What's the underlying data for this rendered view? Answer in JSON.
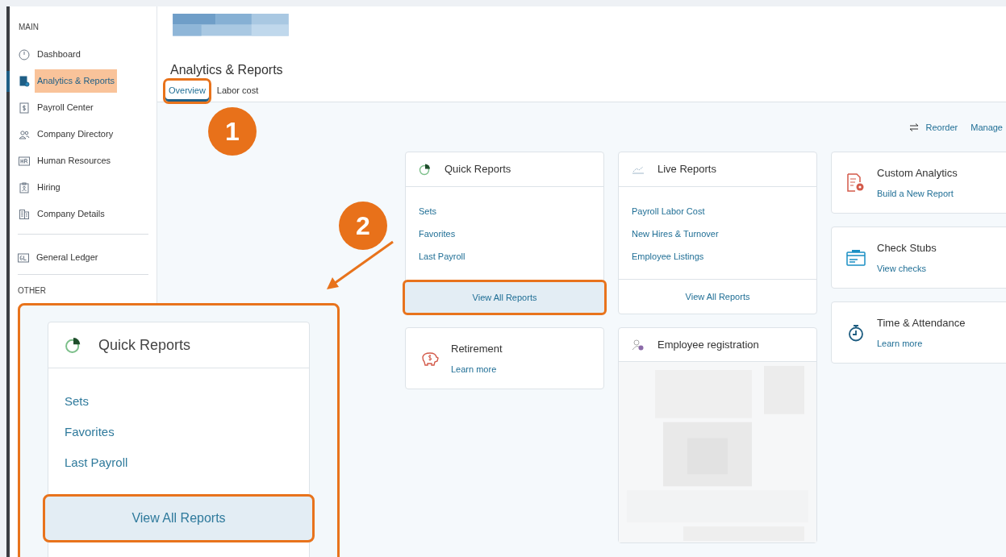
{
  "sidebar": {
    "sections": [
      {
        "heading": "MAIN",
        "items": [
          {
            "label": "Dashboard",
            "kind": "gauge",
            "selected": false
          },
          {
            "label": "Analytics & Reports",
            "kind": "report",
            "selected": true
          },
          {
            "label": "Payroll Center",
            "kind": "dollar",
            "selected": false
          },
          {
            "label": "Company Directory",
            "kind": "people",
            "selected": false
          },
          {
            "label": "Human Resources",
            "kind": "hr",
            "selected": false
          },
          {
            "label": "Hiring",
            "kind": "badge",
            "selected": false
          },
          {
            "label": "Company Details",
            "kind": "building",
            "selected": false
          }
        ]
      },
      {
        "items": [
          {
            "label": "General Ledger",
            "kind": "gl",
            "selected": false
          }
        ]
      },
      {
        "heading": "OTHER"
      }
    ]
  },
  "page": {
    "title": "Analytics & Reports",
    "tabs": [
      {
        "label": "Overview",
        "selected": true,
        "highlighted": true
      },
      {
        "label": "Labor cost",
        "selected": false,
        "highlighted": false
      }
    ]
  },
  "toolbar": {
    "reorder": "Reorder",
    "manage": "Manage"
  },
  "columns": [
    [
      {
        "kind": "list",
        "title": "Quick Reports",
        "links": [
          "Sets",
          "Favorites",
          "Last Payroll"
        ],
        "button": "View All Reports",
        "highlighted": true
      },
      {
        "kind": "promo",
        "title": "Retirement",
        "link": "Learn more"
      }
    ],
    [
      {
        "kind": "list",
        "title": "Live Reports",
        "links": [
          "Payroll Labor Cost",
          "New Hires & Turnover",
          "Employee Listings"
        ],
        "button": "View All Reports",
        "highlighted": false
      },
      {
        "kind": "blurred",
        "title": "Employee registration"
      }
    ],
    [
      {
        "kind": "promo",
        "title": "Custom Analytics",
        "link": "Build a New Report"
      },
      {
        "kind": "promo",
        "title": "Check Stubs",
        "link": "View checks"
      },
      {
        "kind": "promo",
        "title": "Time & Attendance",
        "link": "Learn more"
      }
    ]
  ],
  "steps": [
    "1",
    "2"
  ],
  "callout": {
    "title": "Quick Reports",
    "links": [
      "Sets",
      "Favorites",
      "Last Payroll"
    ],
    "button": "View All Reports"
  }
}
